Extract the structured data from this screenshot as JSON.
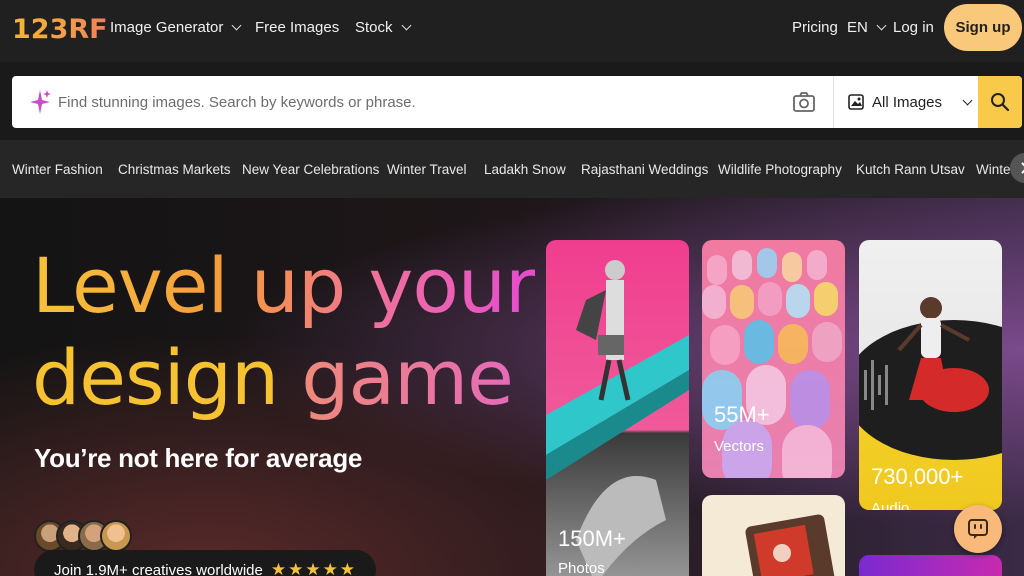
{
  "brand": {
    "logo_text": "123RF"
  },
  "nav": {
    "image_generator": "Image Generator",
    "free_images": "Free Images",
    "stock": "Stock",
    "pricing": "Pricing",
    "language": "EN",
    "login": "Log in",
    "signup": "Sign up"
  },
  "search": {
    "placeholder": "Find stunning images. Search by keywords or phrase.",
    "value": "",
    "filter_selected": "All Images",
    "icons": {
      "left": "sparkle-icon",
      "camera": "camera-icon",
      "filter": "image-icon",
      "submit": "search-icon"
    }
  },
  "trending": {
    "items": [
      "Winter Fashion",
      "Christmas Markets",
      "New Year Celebrations",
      "Winter Travel",
      "Ladakh Snow",
      "Rajasthani Weddings",
      "Wildlife Photography",
      "Kutch Rann Utsav",
      "Winter"
    ]
  },
  "hero": {
    "headline_line1": "Level up your",
    "headline_line2_part1": "design",
    "headline_line2_part2": "game",
    "subhead": "You’re not here for average",
    "join_text": "Join 1.9M+ creatives worldwide",
    "stars": "★★★★★"
  },
  "cards": [
    {
      "stat": "150M+",
      "label": "Photos"
    },
    {
      "stat": "55M+",
      "label": "Vectors"
    },
    {
      "stat": "730,000+",
      "label": "Audio"
    }
  ],
  "colors": {
    "accent_yellow": "#f9c94a",
    "signup_bg": "#f9c87a",
    "nav_bg": "#202020",
    "trending_bg": "#262626"
  }
}
